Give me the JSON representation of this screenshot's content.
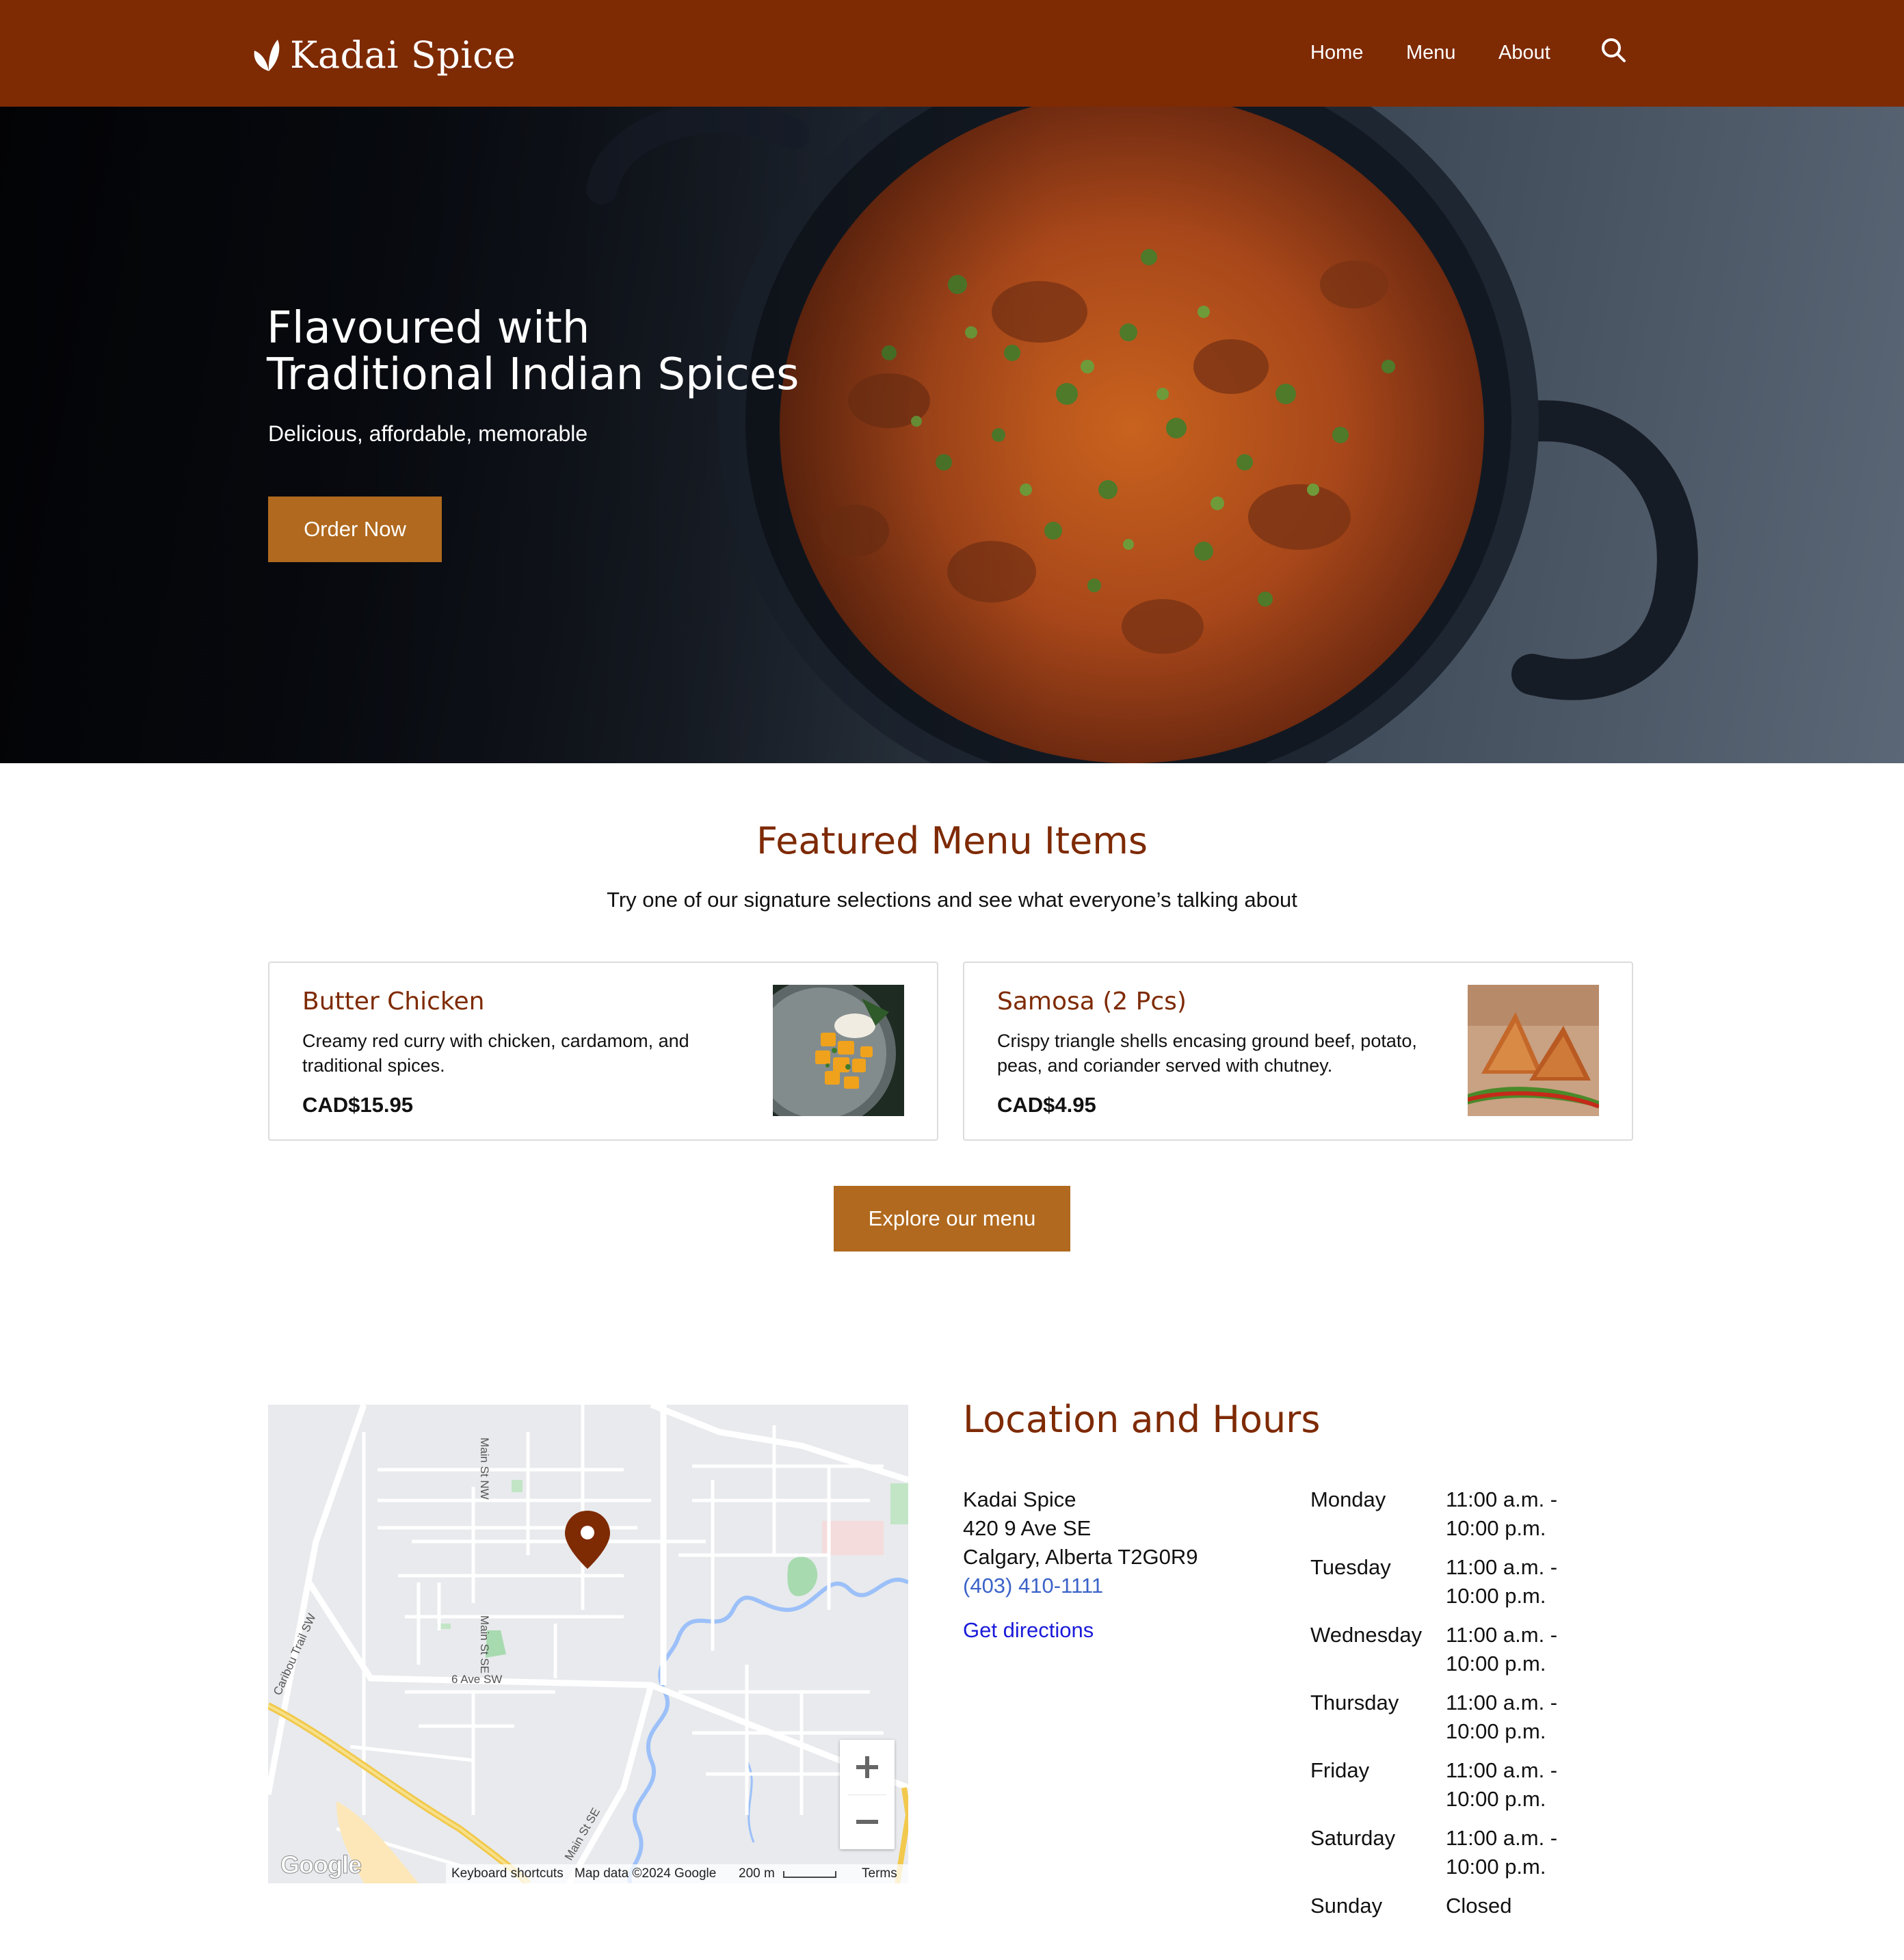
{
  "header": {
    "brand": "Kadai Spice",
    "nav": [
      {
        "label": "Home"
      },
      {
        "label": "Menu"
      },
      {
        "label": "About"
      }
    ],
    "search_icon": "search-icon",
    "background": "#7e2a03"
  },
  "hero": {
    "title_line1": "Flavoured with",
    "title_line2": "Traditional Indian Spices",
    "subtitle": "Delicious, affordable, memorable",
    "cta": "Order Now",
    "cta_color": "#b0691e"
  },
  "featured": {
    "title": "Featured Menu Items",
    "subtitle": "Try one of our signature selections and see what everyone’s talking about",
    "items": [
      {
        "name": "Butter Chicken",
        "description": "Creamy red curry with chicken, cardamom, and traditional spices.",
        "price": "CAD$15.95"
      },
      {
        "name": "Samosa (2 Pcs)",
        "description": "Crispy triangle shells encasing ground beef, potato, peas, and coriander served with chutney.",
        "price": "CAD$4.95"
      }
    ],
    "explore_label": "Explore our menu"
  },
  "map": {
    "streets": [
      "Main St NW",
      "Main St SE",
      "Caribou Trail SW",
      "6 Ave SW",
      "Main St SE"
    ],
    "keyboard_shortcuts": "Keyboard shortcuts",
    "map_data": "Map data ©2024 Google",
    "scale": "200 m",
    "terms": "Terms",
    "logo": "Google",
    "zoom_in": "+",
    "zoom_out": "−"
  },
  "location": {
    "title": "Location and Hours",
    "name": "Kadai Spice",
    "street": "420 9 Ave SE",
    "city": "Calgary, Alberta T2G0R9",
    "phone": "(403) 410-1111",
    "directions": "Get directions",
    "hours": [
      {
        "day": "Monday",
        "time": "11:00 a.m. - 10:00 p.m."
      },
      {
        "day": "Tuesday",
        "time": "11:00 a.m. - 10:00 p.m."
      },
      {
        "day": "Wednesday",
        "time": "11:00 a.m. - 10:00 p.m."
      },
      {
        "day": "Thursday",
        "time": "11:00 a.m. - 10:00 p.m."
      },
      {
        "day": "Friday",
        "time": "11:00 a.m. - 10:00 p.m."
      },
      {
        "day": "Saturday",
        "time": "11:00 a.m. - 10:00 p.m."
      },
      {
        "day": "Sunday",
        "time": "Closed"
      }
    ]
  }
}
